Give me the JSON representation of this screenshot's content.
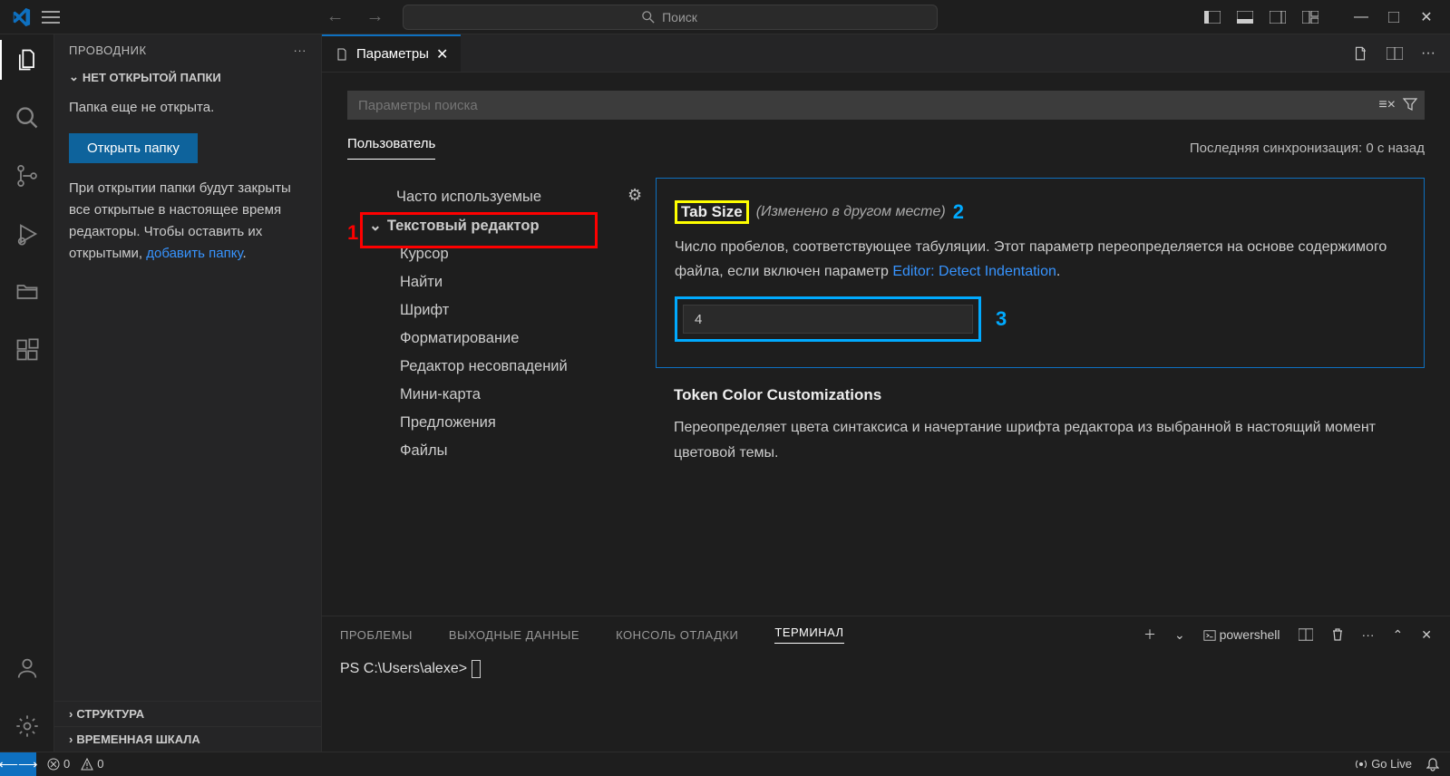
{
  "titlebar": {
    "search_placeholder": "Поиск"
  },
  "sidebar": {
    "title": "ПРОВОДНИК",
    "no_folder_header": "НЕТ ОТКРЫТОЙ ПАПКИ",
    "no_folder_text": "Папка еще не открыта.",
    "open_folder_btn": "Открыть папку",
    "hint_text_1": "При открытии папки будут закрыты все открытые в настоящее время редакторы. Чтобы оставить их открытыми, ",
    "hint_link": "добавить папку",
    "hint_suffix": ".",
    "outline_header": "СТРУКТУРА",
    "timeline_header": "ВРЕМЕННАЯ ШКАЛА"
  },
  "tab": {
    "title": "Параметры"
  },
  "settings": {
    "search_placeholder": "Параметры поиска",
    "user_tab": "Пользователь",
    "sync_status": "Последняя синхронизация: 0 с назад",
    "tree": {
      "frequently_used": "Часто используемые",
      "text_editor": "Текстовый редактор",
      "cursor": "Курсор",
      "find": "Найти",
      "font": "Шрифт",
      "formatting": "Форматирование",
      "diff_editor": "Редактор несовпадений",
      "minimap": "Мини-карта",
      "suggestions": "Предложения",
      "files": "Файлы"
    },
    "annotations": {
      "a1": "1",
      "a2": "2",
      "a3": "3"
    },
    "tab_size": {
      "title": "Tab Size",
      "modified": "(Изменено в другом месте)",
      "desc_1": "Число пробелов, соответствующее табуляции. Этот параметр переопределяется на основе содержимого файла, если включен параметр ",
      "desc_link": "Editor: Detect Indentation",
      "desc_suffix": ".",
      "value": "4"
    },
    "token_color": {
      "title": "Token Color Customizations",
      "desc": "Переопределяет цвета синтаксиса и начертание шрифта редактора из выбранной в настоящий момент цветовой темы."
    }
  },
  "panel": {
    "problems": "ПРОБЛЕМЫ",
    "output": "ВЫХОДНЫЕ ДАННЫЕ",
    "debug_console": "КОНСОЛЬ ОТЛАДКИ",
    "terminal": "ТЕРМИНАЛ",
    "shell": "powershell",
    "prompt": "PS C:\\Users\\alexe> "
  },
  "statusbar": {
    "errors": "0",
    "warnings": "0",
    "go_live": "Go Live"
  }
}
